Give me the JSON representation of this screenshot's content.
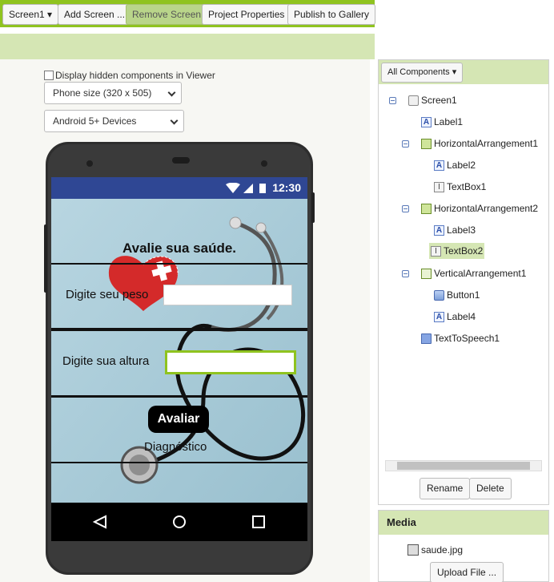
{
  "toolbar": {
    "screen_dropdown": "Screen1 ▾",
    "add_screen": "Add Screen ...",
    "remove_screen": "Remove Screen",
    "project_properties": "Project Properties",
    "publish": "Publish to Gallery"
  },
  "viewer": {
    "display_hidden_label": "Display hidden components in Viewer",
    "display_hidden_checked": false,
    "phone_size_selected": "Phone size (320 x 505)",
    "device_selected": "Android 5+ Devices"
  },
  "app_screen": {
    "status_time": "12:30",
    "title": "Avalie sua saúde.",
    "label_weight": "Digite seu peso",
    "label_height": "Digite sua altura",
    "textbox_weight": "",
    "textbox_height": "",
    "button": "Avaliar",
    "diagnosis": "Diagnóstico"
  },
  "components": {
    "header_button": "All Components ▾",
    "tree": [
      {
        "name": "Screen1",
        "type": "screen",
        "level": 0,
        "collapsible": true
      },
      {
        "name": "Label1",
        "type": "label",
        "level": 1,
        "collapsible": false
      },
      {
        "name": "HorizontalArrangement1",
        "type": "harr",
        "level": 1,
        "collapsible": true
      },
      {
        "name": "Label2",
        "type": "label",
        "level": 2,
        "collapsible": false
      },
      {
        "name": "TextBox1",
        "type": "textbox",
        "level": 2,
        "collapsible": false
      },
      {
        "name": "HorizontalArrangement2",
        "type": "harr",
        "level": 1,
        "collapsible": true
      },
      {
        "name": "Label3",
        "type": "label",
        "level": 2,
        "collapsible": false
      },
      {
        "name": "TextBox2",
        "type": "textbox",
        "level": 2,
        "collapsible": false,
        "selected": true
      },
      {
        "name": "VerticalArrangement1",
        "type": "varr",
        "level": 1,
        "collapsible": true
      },
      {
        "name": "Button1",
        "type": "button",
        "level": 2,
        "collapsible": false
      },
      {
        "name": "Label4",
        "type": "label",
        "level": 2,
        "collapsible": false
      },
      {
        "name": "TextToSpeech1",
        "type": "tts",
        "level": 1,
        "collapsible": false
      }
    ],
    "rename": "Rename",
    "delete": "Delete"
  },
  "media": {
    "title": "Media",
    "file": "saude.jpg",
    "upload": "Upload File ..."
  },
  "colors": {
    "accent": "#8fc31f",
    "panel_header": "#d5e6b4",
    "status_bar": "#2f4794"
  }
}
